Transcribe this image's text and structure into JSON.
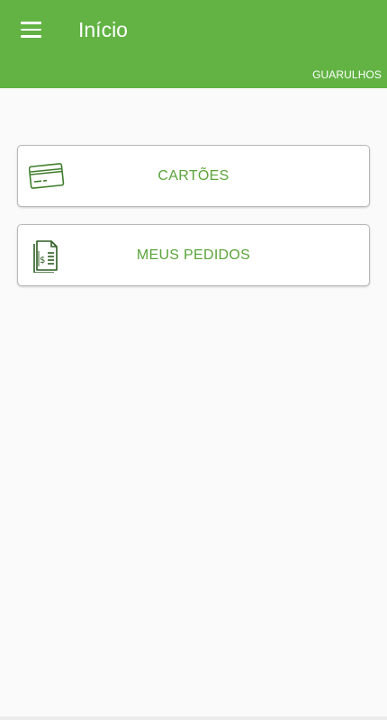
{
  "appbar": {
    "title": "Início",
    "city": "GUARULHOS",
    "color": "#62b344",
    "menu_icon": "hamburger-menu-icon"
  },
  "menu": {
    "items": [
      {
        "label": "CARTÕES",
        "icon": "credit-card-icon"
      },
      {
        "label": "MEUS PEDIDOS",
        "icon": "receipt-dollar-icon"
      }
    ],
    "accent": "#5aa43a"
  }
}
